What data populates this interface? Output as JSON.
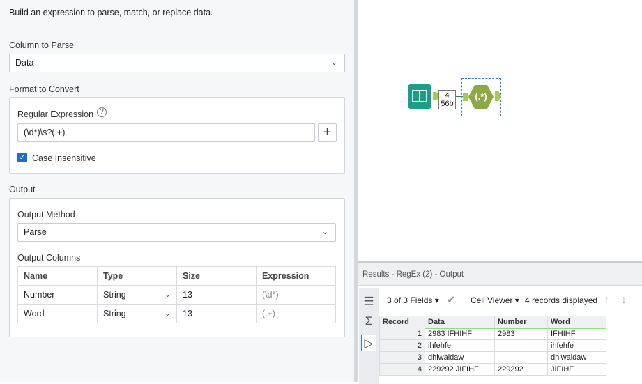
{
  "config": {
    "description": "Build an expression to parse, match, or replace data.",
    "column_to_parse_label": "Column to Parse",
    "column_to_parse_value": "Data",
    "format_label": "Format to Convert",
    "regex_label": "Regular Expression",
    "regex_value": "(\\d*)\\s?(.+)",
    "case_insensitive_label": "Case Insensitive",
    "case_insensitive_checked": true,
    "output_label": "Output",
    "output_method_label": "Output Method",
    "output_method_value": "Parse",
    "output_columns_label": "Output Columns",
    "columns_headers": [
      "Name",
      "Type",
      "Size",
      "Expression"
    ],
    "columns_rows": [
      {
        "name": "Number",
        "type": "String",
        "size": "13",
        "expression": "(\\d*)"
      },
      {
        "name": "Word",
        "type": "String",
        "size": "13",
        "expression": "(.+)"
      }
    ]
  },
  "canvas": {
    "connection_top": "4",
    "connection_bottom": "56b",
    "regex_tool_glyph": "(.*)"
  },
  "results": {
    "title": "Results - RegEx (2) - Output",
    "fields": "3 of 3 Fields",
    "viewer": "Cell Viewer",
    "records_displayed": "4 records displayed",
    "headers": [
      "Record",
      "Data",
      "Number",
      "Word"
    ],
    "rows": [
      [
        "1",
        "2983 IFHIHF",
        "2983",
        "IFHIHF"
      ],
      [
        "2",
        "ihfehfe",
        "",
        "ihfehfe"
      ],
      [
        "3",
        "dhiwaidaw",
        "",
        "dhiwaidaw"
      ],
      [
        "4",
        "229292 JIFIHF",
        "229292",
        "JIFIHF"
      ]
    ]
  }
}
